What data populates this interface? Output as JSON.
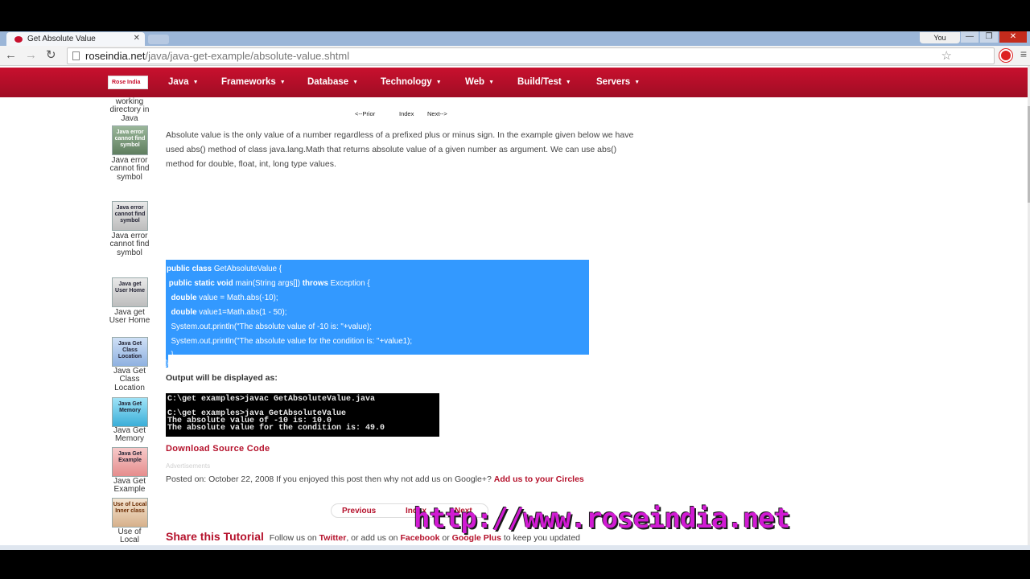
{
  "browser": {
    "tab_title": "Get Absolute Value",
    "tab_close": "✕",
    "user_label": "You",
    "window_buttons": [
      "—",
      "❐",
      "✕"
    ],
    "url_host": "roseindia.net",
    "url_path": "/java/java-get-example/absolute-value.shtml",
    "back_glyph": "←",
    "forward_glyph": "→",
    "reload_glyph": "↻",
    "star_glyph": "☆",
    "menu_glyph": "≡"
  },
  "site_nav": {
    "logo": "Rose India",
    "items": [
      "Java",
      "Frameworks",
      "Database",
      "Technology",
      "Web",
      "Build/Test",
      "Servers"
    ],
    "caret": "▼"
  },
  "sidebar": {
    "top_text": "working directory in Java",
    "items": [
      {
        "thumb": "Java error cannot find symbol",
        "label": "Java error cannot find symbol"
      },
      {
        "thumb": "Java error cannot find symbol",
        "label": "Java error cannot find symbol"
      },
      {
        "thumb": "Java get User Home",
        "label": "Java get User Home"
      },
      {
        "thumb": "Java Get Class Location",
        "label": "Java Get Class Location"
      },
      {
        "thumb": "Java Get Memory",
        "label": "Java Get Memory"
      },
      {
        "thumb": "Java Get Example",
        "label": "Java Get Example"
      },
      {
        "thumb": "Use of Local Inner class",
        "label": "Use of Local"
      }
    ]
  },
  "pager": {
    "prior": "<--Prior",
    "index": "Index",
    "next": "Next-->"
  },
  "intro_text": "Absolute value is the only value of a number regardless of a prefixed plus or minus sign. In the example given below we have used abs() method of class java.lang.Math that returns absolute value  of a given number as argument. We can use abs() method for double, float, int, long type values.",
  "code": {
    "l1_kw": "public class ",
    "l1_rest": "GetAbsoluteValue {",
    "l2_kw": " public static void ",
    "l2_mid": "main(String args[]) ",
    "l2_kw2": "throws ",
    "l2_rest": "Exception {",
    "l3_kw": "  double ",
    "l3_rest": "value = Math.abs(-10);",
    "l4_kw": "  double ",
    "l4_rest": "value1=Math.abs(1 - 50);",
    "l5": "  System.out.println(\"The absolute value of -10 is: \"+value);",
    "l6": "  System.out.println(\"The absolute value for the condition is: \"+value1);",
    "l7": "  }",
    "l8": "}"
  },
  "output_label": "Output will be displayed as:",
  "console_lines": [
    "C:\\get examples>javac GetAbsoluteValue.java",
    "",
    "C:\\get examples>java GetAbsoluteValue",
    "The absolute value of -10 is: 10.0",
    "The absolute value for the condition is: 49.0"
  ],
  "download_link": "Download Source Code",
  "ads_label": "Advertisements",
  "posted": {
    "text": "Posted on: October 22, 2008 If you enjoyed this post then why not add us on Google+?",
    "link": "Add us to your Circles"
  },
  "bottom_pager": {
    "previous": "Previous",
    "index": "Index",
    "next": "Next"
  },
  "share": {
    "title": "Share this Tutorial",
    "follow": "Follow us on",
    "twitter": "Twitter",
    "or_add": ", or add us on",
    "facebook": "Facebook",
    "or": "or",
    "google": "Google Plus",
    "tail": "to keep you updated"
  },
  "watermark": "http://www.roseindia.net",
  "colors": {
    "brand_red": "#c8102e",
    "selection_blue": "#3399ff",
    "watermark_magenta": "#d11bd3"
  }
}
